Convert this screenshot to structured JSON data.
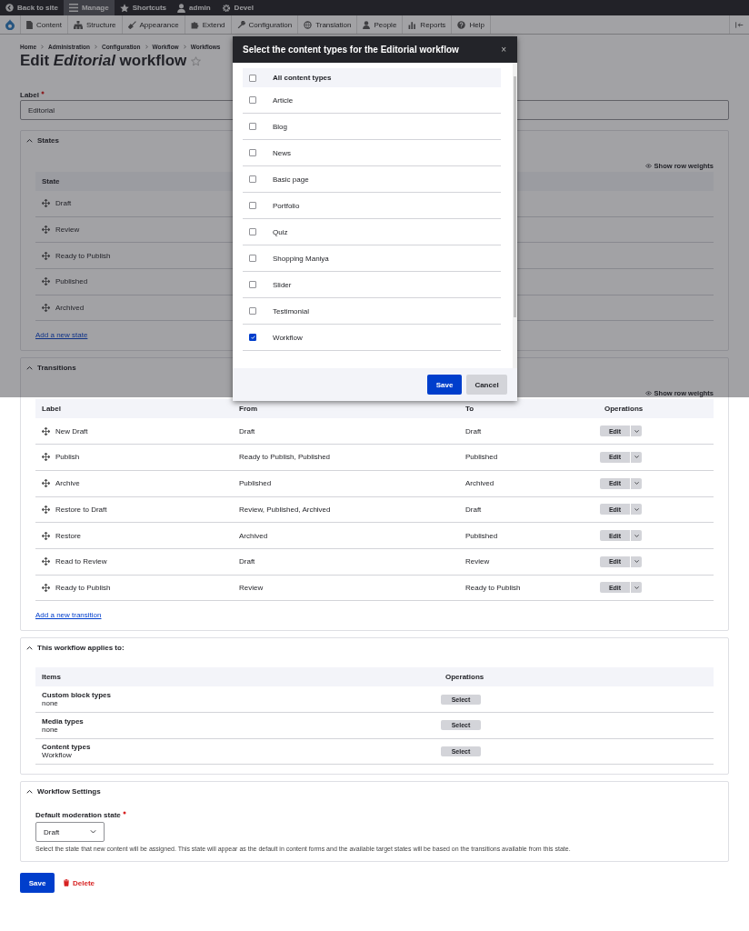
{
  "toolbar": {
    "items": [
      {
        "label": "Back to site",
        "selected": false
      },
      {
        "label": "Manage",
        "selected": true
      },
      {
        "label": "Shortcuts",
        "selected": false
      },
      {
        "label": "admin",
        "selected": false
      },
      {
        "label": "Devel",
        "selected": false
      }
    ]
  },
  "admin_menu": {
    "items": [
      {
        "label": "Content"
      },
      {
        "label": "Structure"
      },
      {
        "label": "Appearance"
      },
      {
        "label": "Extend"
      },
      {
        "label": "Configuration"
      },
      {
        "label": "Translation"
      },
      {
        "label": "People"
      },
      {
        "label": "Reports"
      },
      {
        "label": "Help"
      }
    ]
  },
  "breadcrumb": [
    "Home",
    "Administration",
    "Configuration",
    "Workflow",
    "Workflows"
  ],
  "title": "Edit *Editorial* workflow",
  "label_field": {
    "label": "Label",
    "required": true,
    "value": "Editorial"
  },
  "states": {
    "title": "States",
    "expanded": true,
    "show_row_weights": "Show row weights",
    "columns": [
      "State"
    ],
    "rows": [
      {
        "label": "Draft"
      },
      {
        "label": "Review"
      },
      {
        "label": "Ready to Publish"
      },
      {
        "label": "Published"
      },
      {
        "label": "Archived"
      }
    ],
    "add_link": "Add a new state"
  },
  "transitions": {
    "title": "Transitions",
    "expanded": true,
    "show_row_weights": "Show row weights",
    "columns": [
      "Label",
      "From",
      "To",
      "Operations"
    ],
    "rows": [
      {
        "label": "New Draft",
        "from": "Draft",
        "to": "Draft",
        "operation": "Edit"
      },
      {
        "label": "Publish",
        "from": "Ready to Publish, Published",
        "to": "Published",
        "operation": "Edit"
      },
      {
        "label": "Archive",
        "from": "Published",
        "to": "Archived",
        "operation": "Edit"
      },
      {
        "label": "Restore to Draft",
        "from": "Review, Published, Archived",
        "to": "Draft",
        "operation": "Edit"
      },
      {
        "label": "Restore",
        "from": "Archived",
        "to": "Published",
        "operation": "Edit"
      },
      {
        "label": "Read to Review",
        "from": "Draft",
        "to": "Review",
        "operation": "Edit"
      },
      {
        "label": "Ready to Publish",
        "from": "Review",
        "to": "Ready to Publish",
        "operation": "Edit"
      }
    ],
    "add_link": "Add a new transition"
  },
  "applies": {
    "title": "This workflow applies to:",
    "expanded": true,
    "columns": [
      "Items",
      "Operations"
    ],
    "rows": [
      {
        "name": "Custom block types",
        "value": "none",
        "button": "Select"
      },
      {
        "name": "Media types",
        "value": "none",
        "button": "Select"
      },
      {
        "name": "Content types",
        "value": "Workflow",
        "button": "Select"
      }
    ]
  },
  "settings": {
    "title": "Workflow Settings",
    "expanded": true,
    "field": {
      "label": "Default moderation state",
      "required": true,
      "value": "Draft",
      "description": "Select the state that new content will be assigned. This state will appear as the default in content forms and the available target states will be based on the transitions available from this state."
    }
  },
  "actions": {
    "save": "Save",
    "delete": "Delete"
  },
  "dialog": {
    "title": "Select the content types for the Editorial workflow",
    "close": "×",
    "options": [
      {
        "label": "All content types",
        "kind": "header",
        "checked": false
      },
      {
        "label": "Article",
        "kind": "item",
        "checked": false
      },
      {
        "label": "Blog",
        "kind": "item",
        "checked": false
      },
      {
        "label": "News",
        "kind": "item",
        "checked": false
      },
      {
        "label": "Basic page",
        "kind": "item",
        "checked": false
      },
      {
        "label": "Portfolio",
        "kind": "item",
        "checked": false
      },
      {
        "label": "Quiz",
        "kind": "item",
        "checked": false
      },
      {
        "label": "Shopping Maniya",
        "kind": "item",
        "checked": false
      },
      {
        "label": "Slider",
        "kind": "item",
        "checked": false
      },
      {
        "label": "Testimonial",
        "kind": "item",
        "checked": false
      },
      {
        "label": "Workflow",
        "kind": "item",
        "checked": true
      }
    ],
    "buttons": [
      {
        "label": "Save",
        "kind": "primary"
      },
      {
        "label": "Cancel",
        "kind": "secondary"
      }
    ]
  }
}
